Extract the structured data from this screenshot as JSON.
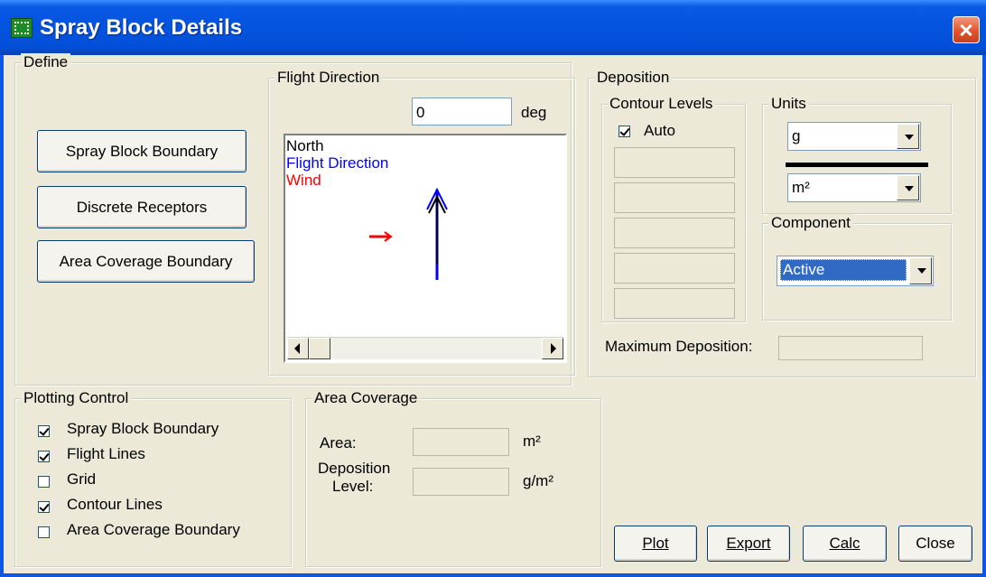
{
  "window": {
    "title": "Spray Block Details",
    "app_icon": "grid-icon",
    "close_icon": "close-icon"
  },
  "define": {
    "label": "Define",
    "buttons": [
      "Spray Block Boundary",
      "Discrete Receptors",
      "Area Coverage Boundary"
    ]
  },
  "flight_direction": {
    "label": "Flight Direction",
    "value": "0",
    "unit": "deg",
    "legend": [
      {
        "label": "North",
        "color": "#000000"
      },
      {
        "label": "Flight Direction",
        "color": "#0000ff"
      },
      {
        "label": "Wind",
        "color": "#ff0000"
      }
    ]
  },
  "deposition": {
    "label": "Deposition",
    "contour_levels": {
      "label": "Contour Levels",
      "auto_label": "Auto",
      "auto_checked": true,
      "levels": [
        "",
        "",
        "",
        "",
        ""
      ]
    },
    "units": {
      "label": "Units",
      "numerator": "g",
      "denominator": "m²"
    },
    "component": {
      "label": "Component",
      "value": "Active"
    },
    "max_label": "Maximum Deposition:",
    "max_value": ""
  },
  "plotting_control": {
    "label": "Plotting Control",
    "items": [
      {
        "label": "Spray Block Boundary",
        "checked": true
      },
      {
        "label": "Flight Lines",
        "checked": true
      },
      {
        "label": "Grid",
        "checked": false
      },
      {
        "label": "Contour Lines",
        "checked": true
      },
      {
        "label": "Area Coverage Boundary",
        "checked": false
      }
    ]
  },
  "area_coverage": {
    "label": "Area Coverage",
    "area_label": "Area:",
    "area_value": "",
    "area_unit": "m²",
    "dep_label_1": "Deposition",
    "dep_label_2": "Level:",
    "dep_value": "",
    "dep_unit": "g/m²"
  },
  "actions": {
    "plot": "Plot",
    "export": "Export",
    "calc": "Calc",
    "close": "Close"
  },
  "colors": {
    "titlebar": "#0a56e8",
    "face": "#ece9d8",
    "selection": "#316ac5",
    "north_arrow": "#000000",
    "flight_arrow": "#0000ff",
    "wind_arrow": "#ff0000"
  }
}
